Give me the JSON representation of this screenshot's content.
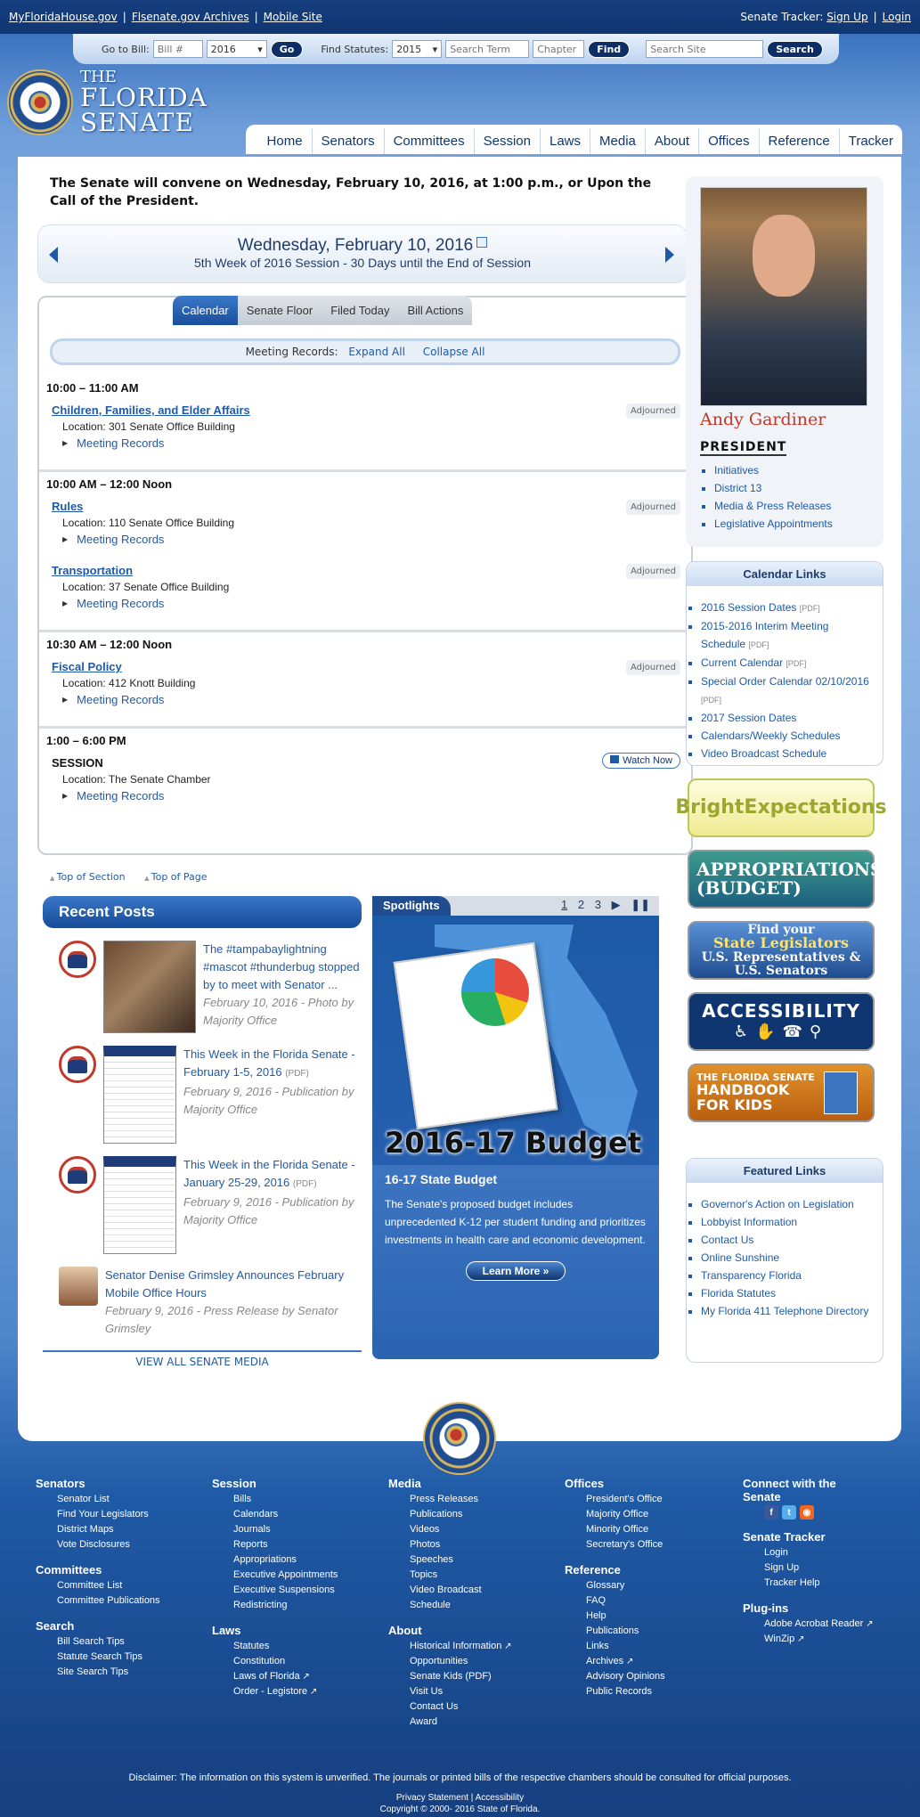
{
  "topbar": {
    "links": [
      "MyFloridaHouse.gov",
      "Flsenate.gov Archives",
      "Mobile Site"
    ],
    "tracker_label": "Senate Tracker:",
    "signup": "Sign Up",
    "login": "Login"
  },
  "searchbar": {
    "goto_label": "Go to Bill:",
    "bill_placeholder": "Bill #",
    "bill_year": "2016",
    "go": "Go",
    "statutes_label": "Find Statutes:",
    "statute_year": "2015",
    "term_placeholder": "Search Term",
    "chapter_placeholder": "Chapter",
    "find": "Find",
    "site_placeholder": "Search Site",
    "search": "Search"
  },
  "logo": {
    "the": "THE",
    "line1": "FLORIDA",
    "line2": "SENATE"
  },
  "nav": [
    "Home",
    "Senators",
    "Committees",
    "Session",
    "Laws",
    "Media",
    "About",
    "Offices",
    "Reference",
    "Tracker"
  ],
  "announcement": "The Senate will convene on Wednesday, February 10, 2016, at 1:00 p.m., or Upon the Call of the President.",
  "date": {
    "main": "Wednesday, February 10, 2016",
    "sub": "5th Week of 2016 Session - 30 Days until the End of Session"
  },
  "tabs": [
    "Calendar",
    "Senate Floor",
    "Filed Today",
    "Bill Actions"
  ],
  "meeting_records": {
    "label": "Meeting Records:",
    "expand": "Expand All",
    "collapse": "Collapse All"
  },
  "schedule": [
    {
      "time": "10:00 – 11:00 AM",
      "meetings": [
        {
          "name": "Children, Families, and Elder Affairs",
          "location": "Location: 301 Senate Office Building",
          "records": "Meeting Records",
          "status": "Adjourned"
        }
      ]
    },
    {
      "time": "10:00 AM – 12:00 Noon",
      "meetings": [
        {
          "name": "Rules",
          "location": "Location: 110 Senate Office Building",
          "records": "Meeting Records",
          "status": "Adjourned"
        },
        {
          "name": "Transportation",
          "location": "Location: 37 Senate Office Building",
          "records": "Meeting Records",
          "status": "Adjourned"
        }
      ]
    },
    {
      "time": "10:30 AM – 12:00 Noon",
      "meetings": [
        {
          "name": "Fiscal Policy",
          "location": "Location: 412 Knott Building",
          "records": "Meeting Records",
          "status": "Adjourned"
        }
      ]
    },
    {
      "time": "1:00 – 6:00 PM",
      "meetings": [
        {
          "name": "SESSION",
          "location": "Location: The Senate Chamber",
          "records": "Meeting Records",
          "status": "Watch Now"
        }
      ]
    }
  ],
  "page_links": {
    "top_section": "Top of Section",
    "top_page": "Top of Page"
  },
  "recent_posts": {
    "heading": "Recent Posts",
    "posts": [
      {
        "title": "The #tampabaylightning #mascot #thunderbug stopped by to meet with Senator ...",
        "meta": "February 10, 2016 - Photo by Majority Office",
        "pdf": ""
      },
      {
        "title": "This Week in the Florida Senate - February 1-5, 2016",
        "meta": "February 9, 2016 - Publication by Majority Office",
        "pdf": "(PDF)"
      },
      {
        "title": "This Week in the Florida Senate - January 25-29, 2016",
        "meta": "February 9, 2016 - Publication by Majority Office",
        "pdf": "(PDF)"
      },
      {
        "title": "Senator Denise Grimsley Announces February Mobile Office Hours",
        "meta": "February 9, 2016 - Press Release by Senator Grimsley",
        "pdf": ""
      }
    ],
    "view_all": "VIEW ALL SENATE MEDIA"
  },
  "spotlights": {
    "heading": "Spotlights",
    "pages": [
      "1",
      "2",
      "3",
      "▶",
      "❚❚"
    ],
    "image_text": "2016-17 Budget",
    "title": "16-17 State Budget",
    "body": "The Senate's proposed budget includes unprecedented K-12 per student funding and prioritizes investments in health care and economic development.",
    "button": "Learn More »"
  },
  "president": {
    "name": "Andy Gardiner",
    "title": "PRESIDENT",
    "links": [
      "Initiatives",
      "District 13",
      "Media & Press Releases",
      "Legislative Appointments"
    ]
  },
  "calendar_links": {
    "heading": "Calendar Links",
    "items": [
      {
        "label": "2016 Session Dates",
        "pdf": "[PDF]"
      },
      {
        "label": "2015-2016 Interim Meeting Schedule",
        "pdf": "[PDF]"
      },
      {
        "label": "Current Calendar",
        "pdf": "[PDF]"
      },
      {
        "label": "Special Order Calendar 02/10/2016",
        "pdf": "[PDF]"
      },
      {
        "label": "2017 Session Dates",
        "pdf": ""
      },
      {
        "label": "Calendars/Weekly Schedules",
        "pdf": ""
      },
      {
        "label": "Video Broadcast Schedule",
        "pdf": ""
      }
    ]
  },
  "banners": {
    "bright": "BrightExpectations",
    "approp_1": "APPROPRIATIONS",
    "approp_2": "(BUDGET)",
    "legis_1": "Find your",
    "legis_2": "State Legislators",
    "legis_3": "U.S. Representatives &",
    "legis_4": "U.S. Senators",
    "access": "ACCESSIBILITY",
    "handbook_1": "THE FLORIDA SENATE",
    "handbook_2": "HANDBOOK",
    "handbook_3": "FOR KIDS"
  },
  "featured_links": {
    "heading": "Featured Links",
    "items": [
      "Governor's Action on Legislation",
      "Lobbyist Information",
      "Contact Us",
      "Online Sunshine",
      "Transparency Florida",
      "Florida Statutes",
      "My Florida 411 Telephone Directory"
    ]
  },
  "footer": {
    "senators": {
      "heading": "Senators",
      "items": [
        "Senator List",
        "Find Your Legislators",
        "District Maps",
        "Vote Disclosures"
      ]
    },
    "committees": {
      "heading": "Committees",
      "items": [
        "Committee List",
        "Committee Publications"
      ]
    },
    "search": {
      "heading": "Search",
      "items": [
        "Bill Search Tips",
        "Statute Search Tips",
        "Site Search Tips"
      ]
    },
    "session": {
      "heading": "Session",
      "items": [
        "Bills",
        "Calendars",
        "Journals",
        "Reports",
        "Appropriations",
        "Executive Appointments",
        "Executive Suspensions",
        "Redistricting"
      ]
    },
    "laws": {
      "heading": "Laws",
      "items": [
        "Statutes",
        "Constitution",
        "Laws of Florida",
        "Order - Legistore"
      ]
    },
    "media": {
      "heading": "Media",
      "items": [
        "Press Releases",
        "Publications",
        "Videos",
        "Photos",
        "Speeches",
        "Topics",
        "Video Broadcast",
        "Schedule"
      ]
    },
    "about": {
      "heading": "About",
      "items": [
        "Historical Information",
        "Opportunities",
        "Senate Kids (PDF)",
        "Visit Us",
        "Contact Us",
        "Award"
      ]
    },
    "offices": {
      "heading": "Offices",
      "items": [
        "President's Office",
        "Majority Office",
        "Minority Office",
        "Secretary's Office"
      ]
    },
    "reference": {
      "heading": "Reference",
      "items": [
        "Glossary",
        "FAQ",
        "Help",
        "Publications",
        "Links",
        "Archives",
        "Advisory Opinions",
        "Public Records"
      ]
    },
    "connect": {
      "heading": "Connect with the Senate"
    },
    "tracker": {
      "heading": "Senate Tracker",
      "items": [
        "Login",
        "Sign Up",
        "Tracker Help"
      ]
    },
    "plugins": {
      "heading": "Plug-ins",
      "items": [
        "Adobe Acrobat Reader",
        "WinZip"
      ]
    },
    "disclaimer": "Disclaimer: The information on this system is unverified. The journals or printed bills of the respective chambers should be consulted for official purposes.",
    "privacy": "Privacy Statement | Accessibility",
    "copyright": "Copyright © 2000- 2016  State of Florida."
  }
}
